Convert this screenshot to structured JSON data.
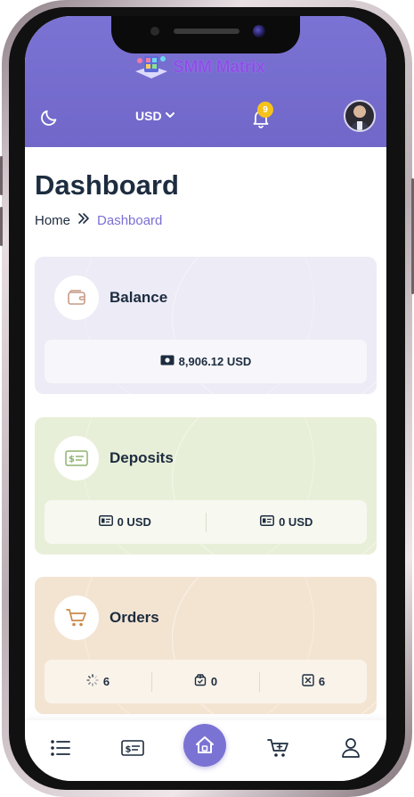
{
  "header": {
    "brand_name": "SMM Matrix",
    "currency": "USD",
    "notification_count": "9"
  },
  "page": {
    "title": "Dashboard",
    "breadcrumb": {
      "home": "Home",
      "current": "Dashboard"
    }
  },
  "cards": {
    "balance": {
      "title": "Balance",
      "amount": "8,906.12 USD"
    },
    "deposits": {
      "title": "Deposits",
      "values": [
        "0 USD",
        "0 USD"
      ]
    },
    "orders": {
      "title": "Orders",
      "values": [
        "6",
        "0",
        "6"
      ]
    }
  },
  "colors": {
    "accent": "#7b73d4",
    "brand_text": "#8d4fe6",
    "badge": "#f5c21c",
    "heading": "#1d2c3f",
    "balance_card": "#ecebf6",
    "deposits_card": "#e8efd8",
    "orders_card": "#f3e4d2"
  },
  "icons": {
    "header": [
      "moon-icon",
      "chevron-down-icon",
      "bell-icon",
      "avatar"
    ],
    "cards": [
      "wallet-icon",
      "money-bill-icon",
      "cart-icon"
    ],
    "order_stats": [
      "loading-icon",
      "package-icon",
      "cancel-box-icon"
    ],
    "bottom_nav": [
      "list-icon",
      "money-bill-icon",
      "home-icon",
      "cart-plus-icon",
      "user-icon"
    ]
  }
}
